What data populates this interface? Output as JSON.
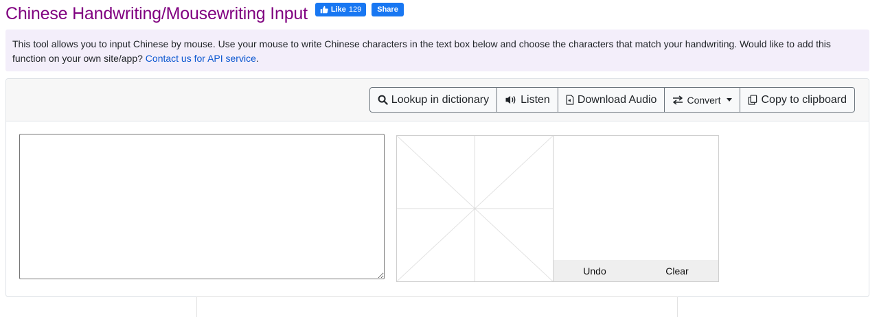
{
  "page": {
    "title": "Chinese Handwriting/Mousewriting Input"
  },
  "social": {
    "like_label": "Like",
    "like_count": "129",
    "share_label": "Share",
    "brand_color": "#1877f2"
  },
  "intro": {
    "text": "This tool allows you to input Chinese by mouse. Use your mouse to write Chinese characters in the text box below and choose the characters that match your handwriting. Would like to add this function on your own site/app? ",
    "link_text": "Contact us for API service",
    "trailing": "."
  },
  "toolbar": {
    "buttons": [
      {
        "label": "Lookup in dictionary",
        "icon": "search-icon"
      },
      {
        "label": "Listen",
        "icon": "speaker-icon"
      },
      {
        "label": "Download Audio",
        "icon": "audio-file-icon"
      },
      {
        "label": "Convert",
        "icon": "swap-arrows-icon"
      },
      {
        "label": "Copy to clipboard",
        "icon": "copy-icon"
      }
    ]
  },
  "editor": {
    "value": "",
    "placeholder": ""
  },
  "candidates": {
    "items": [],
    "undo_label": "Undo",
    "clear_label": "Clear"
  },
  "colors": {
    "title": "#800080",
    "intro_bg": "#f3eefa",
    "link": "#0b57d0"
  }
}
